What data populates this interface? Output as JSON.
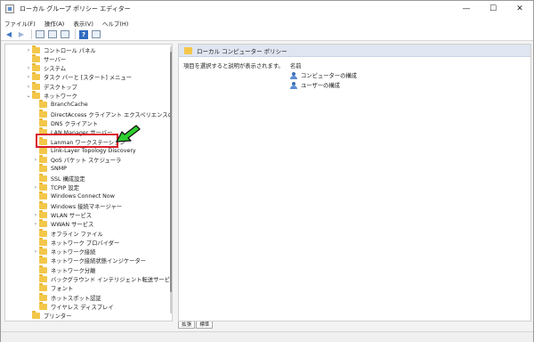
{
  "window": {
    "title": "ローカル グループ ポリシー エディター",
    "controls": {
      "minimize": "—",
      "maximize": "☐",
      "close": "✕"
    }
  },
  "menu": [
    "ファイル(F)",
    "操作(A)",
    "表示(V)",
    "ヘルプ(H)"
  ],
  "toolbar": {
    "back_icon": "arrow-left-icon",
    "forward_icon": "arrow-right-icon",
    "help_label": "?"
  },
  "tree": {
    "items": [
      {
        "label": "コントロール パネル",
        "level": 1,
        "expander": "›"
      },
      {
        "label": "サーバー",
        "level": 1,
        "expander": ""
      },
      {
        "label": "システム",
        "level": 1,
        "expander": "›"
      },
      {
        "label": "タスク バーと [スタート] メニュー",
        "level": 1,
        "expander": "›"
      },
      {
        "label": "デスクトップ",
        "level": 1,
        "expander": "›"
      },
      {
        "label": "ネットワーク",
        "level": 1,
        "expander": "⌄"
      },
      {
        "label": "BranchCache",
        "level": 2,
        "expander": ""
      },
      {
        "label": "DirectAccess クライアント エクスペリエンスの設定",
        "level": 2,
        "expander": ""
      },
      {
        "label": "DNS クライアント",
        "level": 2,
        "expander": ""
      },
      {
        "label": "LAN Manager サーバー",
        "level": 2,
        "expander": ""
      },
      {
        "label": "Lanman ワークステーション",
        "level": 2,
        "expander": ""
      },
      {
        "label": "Link-Layer Topology Discovery",
        "level": 2,
        "expander": ""
      },
      {
        "label": "QoS パケット スケジューラ",
        "level": 2,
        "expander": "›"
      },
      {
        "label": "SNMP",
        "level": 2,
        "expander": ""
      },
      {
        "label": "SSL 構成設定",
        "level": 2,
        "expander": ""
      },
      {
        "label": "TCPIP 設定",
        "level": 2,
        "expander": "›"
      },
      {
        "label": "Windows Connect Now",
        "level": 2,
        "expander": ""
      },
      {
        "label": "Windows 接続マネージャー",
        "level": 2,
        "expander": ""
      },
      {
        "label": "WLAN サービス",
        "level": 2,
        "expander": "›"
      },
      {
        "label": "WWAN サービス",
        "level": 2,
        "expander": "›"
      },
      {
        "label": "オフライン ファイル",
        "level": 2,
        "expander": ""
      },
      {
        "label": "ネットワーク プロバイダー",
        "level": 2,
        "expander": ""
      },
      {
        "label": "ネットワーク接続",
        "level": 2,
        "expander": "›"
      },
      {
        "label": "ネットワーク接続状態インジケーター",
        "level": 2,
        "expander": ""
      },
      {
        "label": "ネットワーク分離",
        "level": 2,
        "expander": ""
      },
      {
        "label": "バックグラウンド インテリジェント転送サービス (BITS)",
        "level": 2,
        "expander": ""
      },
      {
        "label": "フォント",
        "level": 2,
        "expander": ""
      },
      {
        "label": "ホットスポット認証",
        "level": 2,
        "expander": ""
      },
      {
        "label": "ワイヤレス ディスプレイ",
        "level": 2,
        "expander": ""
      },
      {
        "label": "プリンター",
        "level": 1,
        "expander": ""
      }
    ]
  },
  "right_pane": {
    "header": "ローカル コンピューター ポリシー",
    "description": "項目を選択すると説明が表示されます。",
    "column_name": "名前",
    "items": [
      "コンピューターの構成",
      "ユーザーの構成"
    ]
  },
  "tabs": [
    "拡張",
    "標準"
  ],
  "colors": {
    "highlight_border": "#d81e2a",
    "arrow_fill": "#2fcf2f",
    "header_bg": "#dfe6f1",
    "folder": "#f3c74a"
  }
}
